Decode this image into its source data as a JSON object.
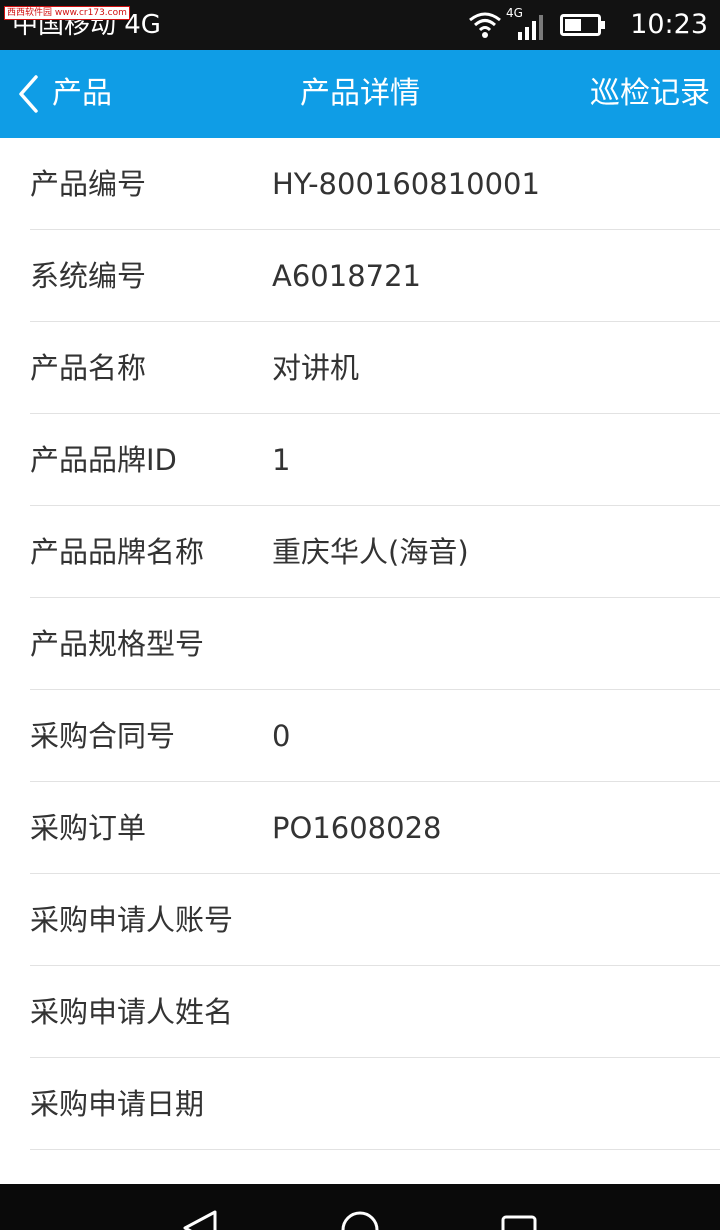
{
  "status_bar": {
    "watermark": "西西软件园 www.cr173.com",
    "carrier": "中国移动 4G",
    "network_badge": "4G",
    "time": "10:23",
    "icons": [
      "wifi-icon",
      "signal-icon",
      "battery-icon"
    ]
  },
  "nav": {
    "back_label": "产品",
    "title": "产品详情",
    "action_label": "巡检记录",
    "bar_color": "#0f9de6"
  },
  "fields": [
    {
      "label": "产品编号",
      "value": "HY-800160810001"
    },
    {
      "label": "系统编号",
      "value": "A6018721"
    },
    {
      "label": "产品名称",
      "value": "对讲机"
    },
    {
      "label": "产品品牌ID",
      "value": "1"
    },
    {
      "label": "产品品牌名称",
      "value": "重庆华人(海音)"
    },
    {
      "label": "产品规格型号",
      "value": ""
    },
    {
      "label": "采购合同号",
      "value": "0"
    },
    {
      "label": "采购订单",
      "value": "PO1608028"
    },
    {
      "label": "采购申请人账号",
      "value": ""
    },
    {
      "label": "采购申请人姓名",
      "value": ""
    },
    {
      "label": "采购申请日期",
      "value": ""
    }
  ],
  "system_nav": {
    "icons": [
      "back-triangle-icon",
      "home-circle-icon",
      "recents-square-icon"
    ]
  }
}
